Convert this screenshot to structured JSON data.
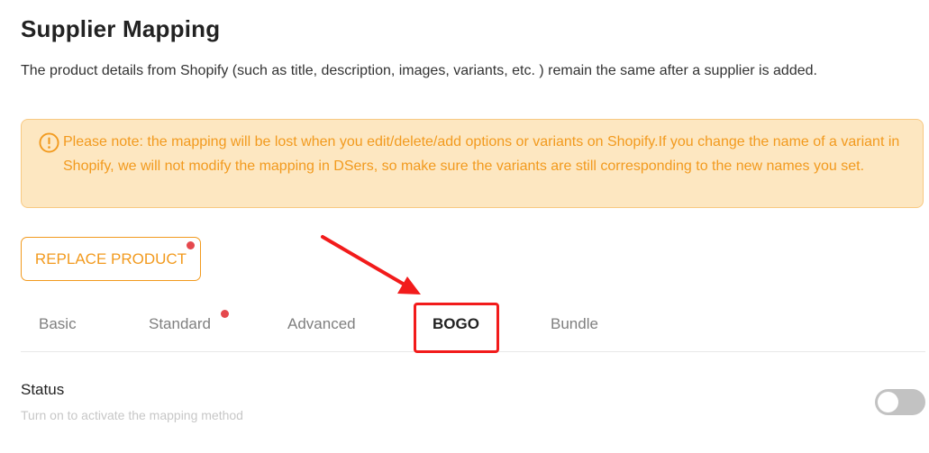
{
  "page": {
    "title": "Supplier Mapping",
    "description": "The product details from Shopify (such as title, description, images, variants, etc. ) remain the same after a supplier is added."
  },
  "notice": {
    "icon": "warning-circle-icon",
    "text": "Please note: the mapping will be lost when you edit/delete/add options or variants on Shopify.If you change the name of a variant in Shopify, we will not modify the mapping in DSers, so make sure the variants are still corresponding to the new names you set."
  },
  "replace_button": {
    "label": "REPLACE PRODUCT",
    "has_badge": true
  },
  "tabs": {
    "items": [
      {
        "label": "Basic",
        "active": false,
        "badge": false
      },
      {
        "label": "Standard",
        "active": false,
        "badge": true
      },
      {
        "label": "Advanced",
        "active": false,
        "badge": false
      },
      {
        "label": "BOGO",
        "active": true,
        "badge": false
      },
      {
        "label": "Bundle",
        "active": false,
        "badge": false
      }
    ]
  },
  "status": {
    "label": "Status",
    "hint": "Turn on to activate the mapping method",
    "enabled": false
  },
  "colors": {
    "accent": "#f29a1e",
    "notice_bg": "#fde7c1",
    "notice_border": "#f8c982",
    "badge": "#e5484d",
    "annotation": "#f21b1b",
    "toggle_off": "#c2c2c2"
  }
}
